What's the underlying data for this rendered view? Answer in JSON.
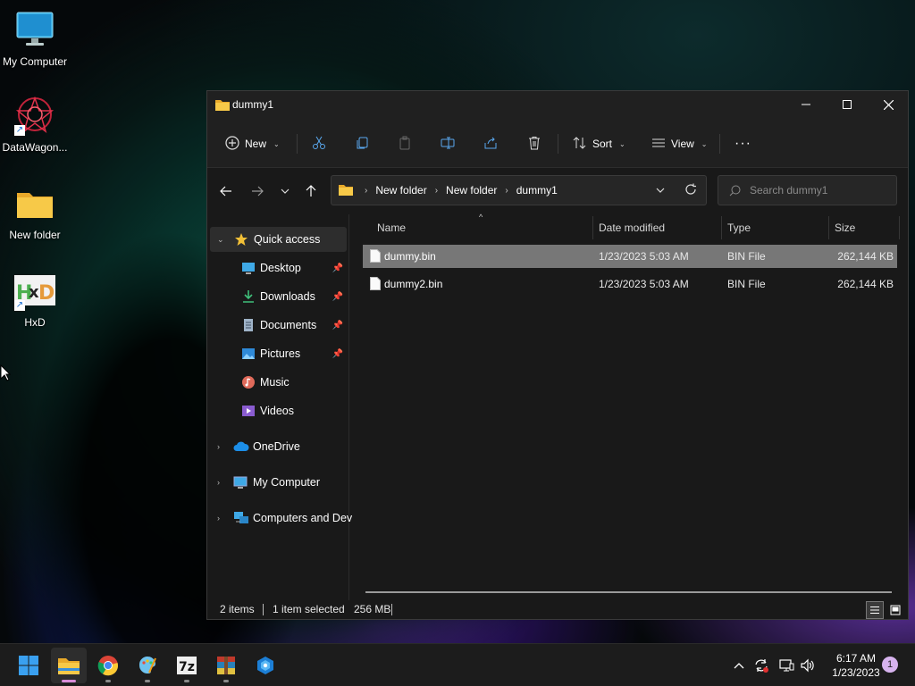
{
  "desktop": {
    "icons": [
      {
        "label": "My Computer",
        "icon": "monitor-icon"
      },
      {
        "label": "DataWagon...",
        "icon": "datawagon-icon"
      },
      {
        "label": "New folder",
        "icon": "folder-icon"
      },
      {
        "label": "HxD",
        "icon": "hxd-icon"
      }
    ]
  },
  "window": {
    "title": "dummy1",
    "toolbar": {
      "new_label": "New",
      "sort_label": "Sort",
      "view_label": "View",
      "more_label": "···"
    },
    "breadcrumb": [
      "New folder",
      "New folder",
      "dummy1"
    ],
    "search_placeholder": "Search dummy1",
    "sidebar": {
      "quick_access": "Quick access",
      "items": [
        {
          "label": "Desktop",
          "icon": "desktop-icon",
          "pinned": true
        },
        {
          "label": "Downloads",
          "icon": "download-icon",
          "pinned": true
        },
        {
          "label": "Documents",
          "icon": "document-icon",
          "pinned": true
        },
        {
          "label": "Pictures",
          "icon": "pictures-icon",
          "pinned": true
        },
        {
          "label": "Music",
          "icon": "music-icon",
          "pinned": false
        },
        {
          "label": "Videos",
          "icon": "videos-icon",
          "pinned": false
        }
      ],
      "onedrive": "OneDrive",
      "my_computer": "My Computer",
      "network": "Computers and Dev"
    },
    "columns": [
      "Name",
      "Date modified",
      "Type",
      "Size"
    ],
    "files": [
      {
        "name": "dummy.bin",
        "date": "1/23/2023 5:03 AM",
        "type": "BIN File",
        "size": "262,144 KB",
        "selected": true
      },
      {
        "name": "dummy2.bin",
        "date": "1/23/2023 5:03 AM",
        "type": "BIN File",
        "size": "262,144 KB",
        "selected": false
      }
    ],
    "status": {
      "items": "2 items",
      "selected": "1 item selected",
      "size": "256 MB"
    }
  },
  "taskbar": {
    "apps": [
      "start-icon",
      "file-explorer-icon",
      "chrome-icon",
      "paint-icon",
      "7zip-icon",
      "winrar-icon",
      "app-icon"
    ],
    "time": "6:17 AM",
    "date": "1/23/2023",
    "notifications": "1"
  },
  "colors": {
    "window_bg": "#191919",
    "selected_row": "#777777",
    "folder_yellow": "#f4c04a",
    "accent_pink": "#d88cd8"
  }
}
